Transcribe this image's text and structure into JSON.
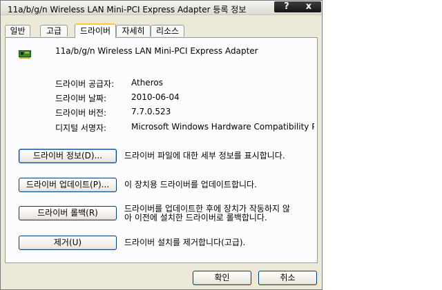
{
  "window": {
    "title": "11a/b/g/n Wireless LAN Mini-PCI Express Adapter 등록 정보",
    "help_label": "?",
    "close_label": "x"
  },
  "tabs": [
    {
      "label": "일반",
      "active": false
    },
    {
      "label": "고급",
      "active": false
    },
    {
      "label": "드라이버",
      "active": true
    },
    {
      "label": "자세히",
      "active": false
    },
    {
      "label": "리소스",
      "active": false
    }
  ],
  "device": {
    "name": "11a/b/g/n Wireless LAN Mini-PCI Express Adapter",
    "icon": "network-card-icon"
  },
  "properties": [
    {
      "label": "드라이버 공급자:",
      "value": "Atheros"
    },
    {
      "label": "드라이버 날짜:",
      "value": "2010-06-04"
    },
    {
      "label": "드라이버 버전:",
      "value": "7.7.0.523"
    },
    {
      "label": "디지털 서명자:",
      "value": "Microsoft Windows Hardware Compatibility Pul"
    }
  ],
  "actions": [
    {
      "button": "드라이버 정보(D)...",
      "description": "드라이버 파일에 대한 세부 정보를 표시합니다."
    },
    {
      "button": "드라이버 업데이트(P)...",
      "description": "이 장치용 드라이버를 업데이트합니다."
    },
    {
      "button": "드라이버 롤백(R)",
      "description_line1": "드라이버를 업데이트한 후에 장치가 작동하지 않",
      "description_line2": "아 이전에 설치한 드라이버로 롤백합니다."
    },
    {
      "button": "제거(U)",
      "description": "드라이버 설치를 제거합니다(고급)."
    }
  ],
  "footer": {
    "ok_label": "확인",
    "cancel_label": "취소"
  },
  "colors": {
    "dialog_bg": "#ece9d8",
    "panel_bg": "#fcfcfe",
    "active_tab_accent": "#ffc83c",
    "button_border": "#003c74"
  }
}
